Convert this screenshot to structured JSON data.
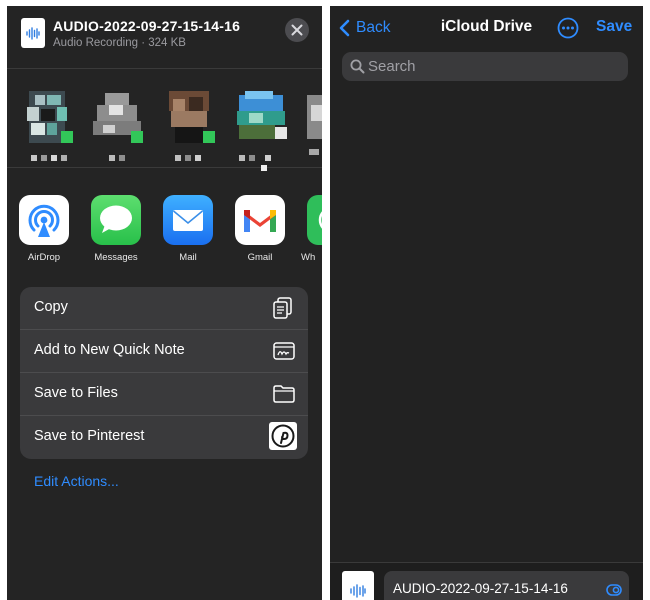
{
  "share_sheet": {
    "file_title": "AUDIO-2022-09-27-15-14-16",
    "file_subtitle": "Audio Recording · 324 KB",
    "apps": [
      {
        "label": "AirDrop",
        "icon": "airdrop-icon"
      },
      {
        "label": "Messages",
        "icon": "messages-icon"
      },
      {
        "label": "Mail",
        "icon": "mail-icon"
      },
      {
        "label": "Gmail",
        "icon": "gmail-icon"
      },
      {
        "label": "Wh",
        "icon": "whatsapp-icon"
      }
    ],
    "actions": [
      {
        "label": "Copy",
        "icon": "copy-icon"
      },
      {
        "label": "Add to New Quick Note",
        "icon": "quick-note-icon"
      },
      {
        "label": "Save to Files",
        "icon": "folder-icon"
      },
      {
        "label": "Save to Pinterest",
        "icon": "pinterest-icon"
      }
    ],
    "edit_actions": "Edit Actions..."
  },
  "files_picker": {
    "back_label": "Back",
    "title": "iCloud Drive",
    "save_label": "Save",
    "search_placeholder": "Search",
    "file_name": "AUDIO-2022-09-27-15-14-16"
  },
  "colors": {
    "accent": "#2f8cff",
    "panel_bg": "#242424",
    "group_bg": "#3a3a3c"
  }
}
